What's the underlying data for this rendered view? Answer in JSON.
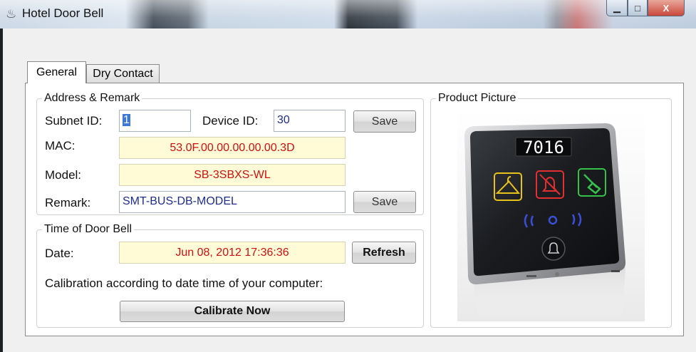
{
  "window": {
    "title": "Hotel Door Bell",
    "icon": "hotel-app-icon",
    "controls": {
      "minimize": "▁",
      "maximize": "□",
      "close": "X"
    }
  },
  "tabs": [
    {
      "label": "General",
      "active": true
    },
    {
      "label": "Dry Contact",
      "active": false
    }
  ],
  "address_remark": {
    "legend": "Address & Remark",
    "subnet_label": "Subnet ID:",
    "subnet_value": "1",
    "device_label": "Device ID:",
    "device_value": "30",
    "save_label": "Save",
    "mac_label": "MAC:",
    "mac_value": "53.0F.00.00.00.00.00.3D",
    "model_label": "Model:",
    "model_value": "SB-3SBXS-WL",
    "remark_label": "Remark:",
    "remark_value": "SMT-BUS-DB-MODEL",
    "remark_save_label": "Save"
  },
  "time": {
    "legend": "Time of Door Bell",
    "date_label": "Date:",
    "date_value": "Jun 08, 2012 17:36:36",
    "refresh_label": "Refresh",
    "calibration_text": "Calibration according to date time of your computer:",
    "calibrate_label": "Calibrate Now"
  },
  "product": {
    "legend": "Product Picture",
    "display_number": "7016",
    "icons": [
      "hanger-icon",
      "do-not-disturb-bell-icon",
      "cleaning-brush-icon",
      "wireless-icon",
      "bell-button-icon"
    ],
    "colors": {
      "yellow": "#e7c21a",
      "red": "#e23030",
      "green": "#34c24a",
      "blue": "#3b4fd6"
    }
  },
  "colors": {
    "value_blue": "#1f2d8a",
    "value_red": "#cc1111",
    "readonly_bg": "#fffbd6"
  }
}
